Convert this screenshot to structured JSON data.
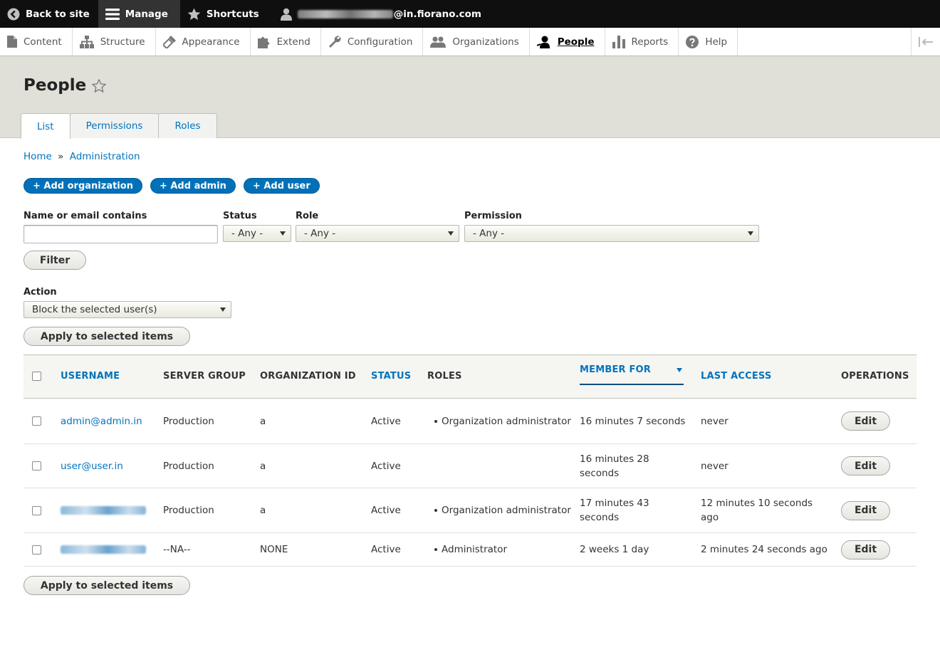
{
  "toolbar": {
    "back_to_site": "Back to site",
    "manage": "Manage",
    "shortcuts": "Shortcuts",
    "user_email_suffix": "@in.fiorano.com"
  },
  "tray": {
    "items": [
      {
        "label": "Content",
        "icon": "file-icon"
      },
      {
        "label": "Structure",
        "icon": "sitemap-icon"
      },
      {
        "label": "Appearance",
        "icon": "paintbrush-icon"
      },
      {
        "label": "Extend",
        "icon": "puzzle-icon"
      },
      {
        "label": "Configuration",
        "icon": "wrench-icon"
      },
      {
        "label": "Organizations",
        "icon": "people-icon"
      },
      {
        "label": "People",
        "icon": "person-icon",
        "active": true
      },
      {
        "label": "Reports",
        "icon": "bar-chart-icon"
      },
      {
        "label": "Help",
        "icon": "question-icon"
      }
    ]
  },
  "page": {
    "title": "People"
  },
  "tabs": [
    "List",
    "Permissions",
    "Roles"
  ],
  "breadcrumb": {
    "home": "Home",
    "separator": "»",
    "administration": "Administration"
  },
  "actions": {
    "add_organization": "+ Add organization",
    "add_admin": "+ Add admin",
    "add_user": "+ Add user"
  },
  "filters": {
    "name_label": "Name or email contains",
    "name_value": "",
    "status_label": "Status",
    "status_value": "- Any -",
    "role_label": "Role",
    "role_value": "- Any -",
    "permission_label": "Permission",
    "permission_value": "- Any -",
    "filter_button": "Filter"
  },
  "bulk": {
    "action_label": "Action",
    "action_value": "Block the selected user(s)",
    "apply_button": "Apply to selected items",
    "apply_button_bottom": "Apply to selected items"
  },
  "table": {
    "headers": {
      "username": "Username",
      "server_group": "Server Group",
      "organization_id": "Organization ID",
      "status": "Status",
      "roles": "Roles",
      "member_for": "Member for",
      "last_access": "Last access",
      "operations": "Operations"
    },
    "rows": [
      {
        "username": "admin@admin.in",
        "server_group": "Production",
        "organization_id": "a",
        "status": "Active",
        "roles": [
          "Organization administrator"
        ],
        "member_for": "16 minutes 7 seconds",
        "last_access": "never",
        "operation": "Edit"
      },
      {
        "username": "user@user.in",
        "server_group": "Production",
        "organization_id": "a",
        "status": "Active",
        "roles": [],
        "member_for": "16 minutes 28 seconds",
        "last_access": "never",
        "operation": "Edit"
      },
      {
        "username": "",
        "server_group": "Production",
        "organization_id": "a",
        "status": "Active",
        "roles": [
          "Organization administrator"
        ],
        "member_for": "17 minutes 43 seconds",
        "last_access": "12 minutes 10 seconds ago",
        "operation": "Edit"
      },
      {
        "username": "",
        "server_group": "--NA--",
        "organization_id": "NONE",
        "status": "Active",
        "roles": [
          "Administrator"
        ],
        "member_for": "2 weeks 1 day",
        "last_access": "2 minutes 24 seconds ago",
        "operation": "Edit"
      }
    ]
  }
}
